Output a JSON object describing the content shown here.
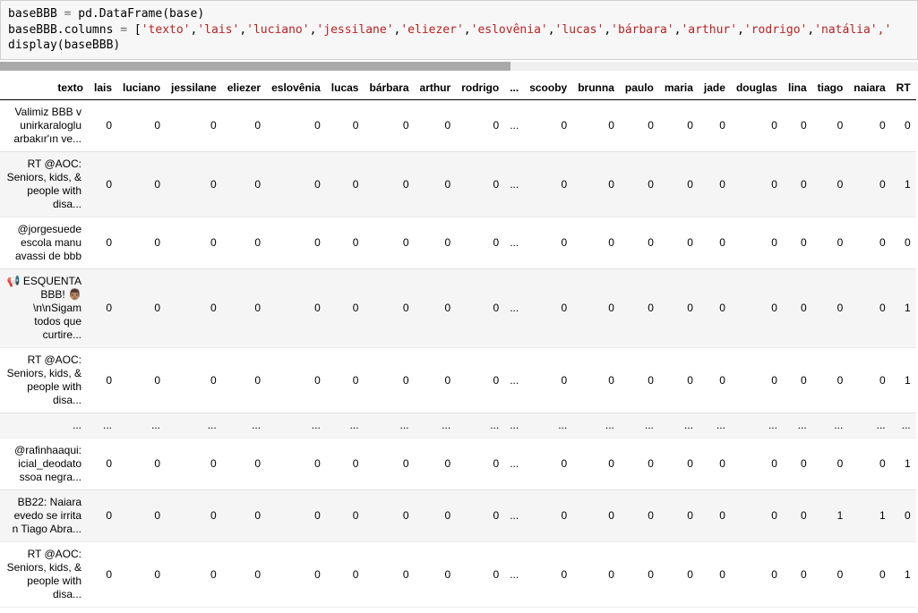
{
  "code": {
    "line1_pre": "baseBBB ",
    "line1_eq": "=",
    "line1_post": " pd.DataFrame(base)",
    "line2_pre": "baseBBB.columns ",
    "line2_eq": "=",
    "line2_post_open": " [",
    "line2_strings": [
      "'texto'",
      "'lais'",
      "'luciano'",
      "'jessilane'",
      "'eliezer'",
      "'eslovênia'",
      "'lucas'",
      "'bárbara'",
      "'arthur'",
      "'rodrigo'",
      "'natália'"
    ],
    "line2_trail": ",'",
    "line3": "display(baseBBB)"
  },
  "columns": [
    "texto",
    "lais",
    "luciano",
    "jessilane",
    "eliezer",
    "eslovênia",
    "lucas",
    "bárbara",
    "arthur",
    "rodrigo",
    "...",
    "scooby",
    "brunna",
    "paulo",
    "maria",
    "jade",
    "douglas",
    "lina",
    "tiago",
    "naiara",
    "RT"
  ],
  "rows": [
    {
      "idx": "Valimiz BBB v unirkaraloglu arbakır'ın ve...",
      "vals": [
        0,
        0,
        0,
        0,
        0,
        0,
        0,
        0,
        0,
        "...",
        0,
        0,
        0,
        0,
        0,
        0,
        0,
        0,
        0,
        0
      ]
    },
    {
      "idx": "RT @AOC: Seniors, kids, &amp; people with disa...",
      "vals": [
        0,
        0,
        0,
        0,
        0,
        0,
        0,
        0,
        0,
        "...",
        0,
        0,
        0,
        0,
        0,
        0,
        0,
        0,
        0,
        1
      ]
    },
    {
      "idx": "@jorgesuede escola manu avassi de bbb",
      "vals": [
        0,
        0,
        0,
        0,
        0,
        0,
        0,
        0,
        0,
        "...",
        0,
        0,
        0,
        0,
        0,
        0,
        0,
        0,
        0,
        0
      ]
    },
    {
      "idx": "📢 ESQUENTA BBB! 👨🏽\\n\\nSigam todos que curtire...",
      "vals": [
        0,
        0,
        0,
        0,
        0,
        0,
        0,
        0,
        0,
        "...",
        0,
        0,
        0,
        0,
        0,
        0,
        0,
        0,
        0,
        1
      ]
    },
    {
      "idx": "RT @AOC: Seniors, kids, &amp; people with disa...",
      "vals": [
        0,
        0,
        0,
        0,
        0,
        0,
        0,
        0,
        0,
        "...",
        0,
        0,
        0,
        0,
        0,
        0,
        0,
        0,
        0,
        1
      ]
    },
    {
      "idx": "...",
      "vals": [
        "...",
        "...",
        "...",
        "...",
        "...",
        "...",
        "...",
        "...",
        "...",
        "...",
        "...",
        "...",
        "...",
        "...",
        "...",
        "...",
        "...",
        "...",
        "...",
        "..."
      ]
    },
    {
      "idx": "@rafinhaaqui: icial_deodato ssoa negra...",
      "vals": [
        0,
        0,
        0,
        0,
        0,
        0,
        0,
        0,
        0,
        "...",
        0,
        0,
        0,
        0,
        0,
        0,
        0,
        0,
        0,
        1
      ]
    },
    {
      "idx": "BB22: Naiara evedo se irrita n Tiago Abra...",
      "vals": [
        0,
        0,
        0,
        0,
        0,
        0,
        0,
        0,
        0,
        "...",
        0,
        0,
        0,
        0,
        0,
        0,
        0,
        1,
        1,
        0
      ]
    },
    {
      "idx": "RT @AOC: Seniors, kids, &amp; people with disa...",
      "vals": [
        0,
        0,
        0,
        0,
        0,
        0,
        0,
        0,
        0,
        "...",
        0,
        0,
        0,
        0,
        0,
        0,
        0,
        0,
        0,
        1
      ]
    }
  ]
}
